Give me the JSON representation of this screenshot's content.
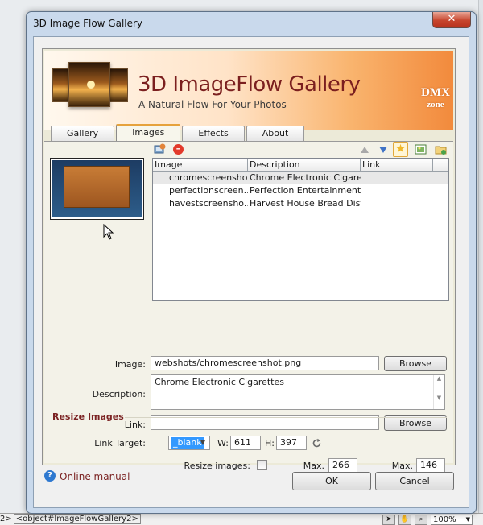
{
  "window": {
    "title": "3D Image Flow Gallery",
    "close_glyph": "✕"
  },
  "banner": {
    "title": "3D ImageFlow Gallery",
    "subtitle": "A Natural Flow For Your Photos",
    "logo_top": "DMX",
    "logo_bottom": "zone"
  },
  "tabs": [
    {
      "label": "Gallery",
      "active": false
    },
    {
      "label": "Images",
      "active": true
    },
    {
      "label": "Effects",
      "active": false
    },
    {
      "label": "About",
      "active": false
    }
  ],
  "toolbar": {
    "icons": [
      "add-image-icon",
      "delete-icon",
      "move-up-icon",
      "move-down-icon",
      "favorite-star-icon",
      "image-properties-icon",
      "add-folder-icon"
    ]
  },
  "image_list": {
    "columns": [
      "Image",
      "Description",
      "Link"
    ],
    "rows": [
      {
        "image": "chromescreensho...",
        "description": "Chrome Electronic Cigaret...",
        "link": ""
      },
      {
        "image": "perfectionscreen...",
        "description": "Perfection Entertainment ...",
        "link": ""
      },
      {
        "image": "havestscreensho...",
        "description": "Harvest House Bread Dist...",
        "link": ""
      }
    ],
    "selected_index": 0
  },
  "form": {
    "image_label": "Image:",
    "image_value": "webshots/chromescreenshot.png",
    "browse_label": "Browse",
    "description_label": "Description:",
    "description_value": "Chrome Electronic Cigarettes",
    "link_label": "Link:",
    "link_value": "",
    "link_browse_label": "Browse",
    "link_target_label": "Link Target:",
    "link_target_value": "_blank",
    "w_label": "W:",
    "w_value": "611",
    "h_label": "H:",
    "h_value": "397"
  },
  "resize": {
    "section_title": "Resize Images",
    "resize_label": "Resize images:",
    "resize_checked": false,
    "max_width_label": "Max. Width:",
    "max_width_value": "266",
    "max_height_label": "Max. Height:",
    "max_height_value": "146"
  },
  "footer": {
    "help_glyph": "?",
    "help_label": "Online manual",
    "ok_label": "OK",
    "cancel_label": "Cancel"
  },
  "statusbar": {
    "path_prefix": "2>",
    "path_tag": "<object#ImageFlowGallery2>",
    "zoom": "100%"
  }
}
